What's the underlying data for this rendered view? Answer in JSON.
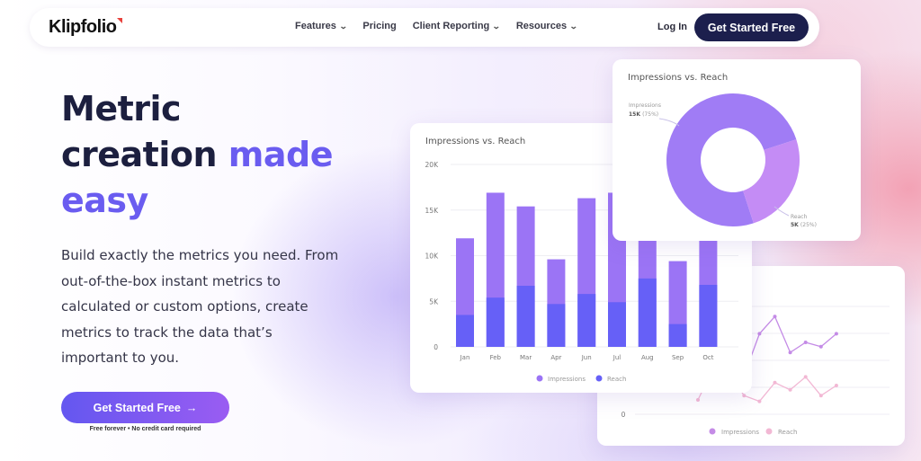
{
  "nav": {
    "logo": "Klipfolio",
    "links": [
      {
        "label": "Features",
        "has_dropdown": true
      },
      {
        "label": "Pricing",
        "has_dropdown": false
      },
      {
        "label": "Client Reporting",
        "has_dropdown": true
      },
      {
        "label": "Resources",
        "has_dropdown": true
      }
    ],
    "login_label": "Log In",
    "cta_label": "Get Started Free"
  },
  "hero": {
    "headline_line1": "Metric",
    "headline_line2_dark": "creation",
    "headline_line2_accent": "made",
    "headline_line3_accent": "easy",
    "description": "Build exactly the metrics you need. From out-of-the-box instant metrics to calculated or custom options, create metrics to track the data that’s important to you.",
    "cta_label": "Get Started Free",
    "cta_arrow": "→",
    "fine_print": "Free forever • No credit card required"
  },
  "colors": {
    "navy": "#1c1f4d",
    "accent": "#6a5cf0",
    "impressions": "#9b74f5",
    "reach": "#6660f7",
    "donut_impressions": "#a07cf5",
    "donut_reach": "#c48cf5",
    "line_impressions": "#c48be6",
    "line_reach": "#f2b8d4"
  },
  "chart_data": [
    {
      "type": "bar",
      "title": "Impressions vs. Reach",
      "categories": [
        "Jan",
        "Feb",
        "Mar",
        "Apr",
        "Jun",
        "Jul",
        "Aug",
        "Sep",
        "Oct"
      ],
      "series": [
        {
          "name": "Impressions",
          "values": [
            11900,
            16900,
            15400,
            9600,
            16300,
            16900,
            12000,
            9400,
            12000
          ]
        },
        {
          "name": "Reach",
          "values": [
            3500,
            5400,
            6700,
            4700,
            5800,
            4900,
            7500,
            2500,
            6800
          ]
        }
      ],
      "ylim": [
        0,
        20000
      ],
      "yticks": [
        "0",
        "5K",
        "10K",
        "15K",
        "20K"
      ],
      "legend": [
        "Impressions",
        "Reach"
      ],
      "legend_position": "bottom",
      "grid": true
    },
    {
      "type": "pie",
      "title": "Impressions vs. Reach",
      "labels": [
        "Impressions",
        "Reach"
      ],
      "values": [
        15000,
        5000
      ],
      "value_labels": [
        "15K",
        "5K"
      ],
      "percent_labels": [
        "(75%)",
        "(25%)"
      ],
      "donut": true
    },
    {
      "type": "line",
      "series": [
        {
          "name": "Impressions",
          "values": [
            15.5,
            13.2,
            13.6,
            5.4,
            11.2,
            13.6,
            8.6,
            10.0,
            9.4,
            11.2
          ]
        },
        {
          "name": "Reach",
          "values": [
            2.0,
            6.4,
            5.8,
            2.6,
            1.8,
            4.4,
            3.4,
            5.2,
            2.6,
            4.0
          ]
        }
      ],
      "ytick_visible": "0",
      "legend": [
        "Impressions",
        "Reach"
      ],
      "legend_position": "bottom",
      "grid": true
    }
  ]
}
